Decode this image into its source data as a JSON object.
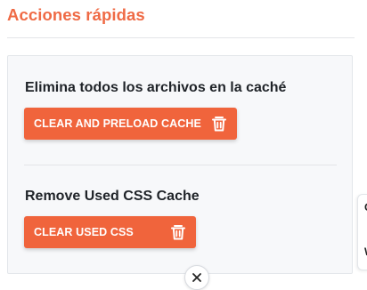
{
  "section": {
    "title": "Acciones rápidas"
  },
  "cache_block": {
    "title": "Elimina todos los archivos en la caché",
    "button_label": "CLEAR AND PRELOAD CACHE",
    "button_icon": "trash-icon"
  },
  "css_block": {
    "title": "Remove Used CSS Cache",
    "button_label": "CLEAR USED CSS",
    "button_icon": "trash-icon"
  },
  "side_tab": {
    "top_char": "C",
    "bottom_char": "W"
  },
  "close": {
    "icon": "close-icon"
  },
  "colors": {
    "accent": "#ef6a45",
    "button_bg": "#f0643c",
    "panel_bg": "#f7f8fa",
    "text": "#1f2328"
  }
}
